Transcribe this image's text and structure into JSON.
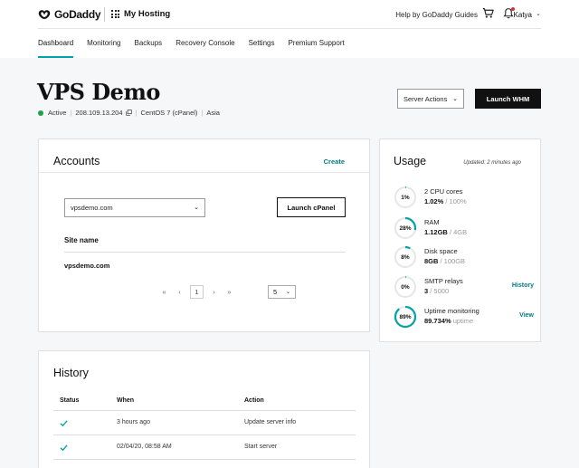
{
  "brand": {
    "name": "GoDaddy",
    "accent": "#00a4a6"
  },
  "header": {
    "product": "My Hosting",
    "help_link": "Help by GoDaddy Guides",
    "user": "Katya"
  },
  "tabs": [
    {
      "label": "Dashboard",
      "active": true
    },
    {
      "label": "Monitoring"
    },
    {
      "label": "Backups"
    },
    {
      "label": "Recovery Console"
    },
    {
      "label": "Settings"
    },
    {
      "label": "Premium Support"
    }
  ],
  "server": {
    "title": "VPS Demo",
    "status": "Active",
    "ip": "208.109.13.204",
    "os": "CentOS 7 (cPanel)",
    "region": "Asia",
    "status_color": "#1ba34a",
    "actions_label": "Server Actions",
    "launch_whm_label": "Launch WHM"
  },
  "accounts": {
    "title": "Accounts",
    "create_label": "Create",
    "selected_account": "vpsdemo.com",
    "launch_cpanel_label": "Launch cPanel",
    "column_site_name": "Site name",
    "sites": [
      "vpsdemo.com"
    ],
    "pager": {
      "first": "«",
      "prev": "‹",
      "current_page": "1",
      "next": "›",
      "last": "»",
      "page_size": "5"
    }
  },
  "usage": {
    "title": "Usage",
    "updated": "Updated: 2 minutes ago",
    "items": [
      {
        "label_pct": "1%",
        "pct": 1,
        "name": "2 CPU cores",
        "used": "1.02%",
        "total": "/ 100%",
        "link": ""
      },
      {
        "label_pct": "28%",
        "pct": 28,
        "name": "RAM",
        "used": "1.12GB",
        "total": "/ 4GB",
        "link": ""
      },
      {
        "label_pct": "8%",
        "pct": 8,
        "name": "Disk space",
        "used": "8GB",
        "total": "/ 100GB",
        "link": ""
      },
      {
        "label_pct": "0%",
        "pct": 0,
        "name": "SMTP relays",
        "used": "3",
        "total": "/ 5000",
        "link": "History"
      },
      {
        "label_pct": "89%",
        "pct": 89,
        "name": "Uptime monitoring",
        "used": "89.734%",
        "total": "uptime",
        "link": "View"
      }
    ]
  },
  "history": {
    "title": "History",
    "columns": {
      "status": "Status",
      "when": "When",
      "action": "Action"
    },
    "rows": [
      {
        "when": "3 hours ago",
        "action": "Update server info"
      },
      {
        "when": "02/04/20, 08:58 AM",
        "action": "Start server"
      }
    ]
  }
}
